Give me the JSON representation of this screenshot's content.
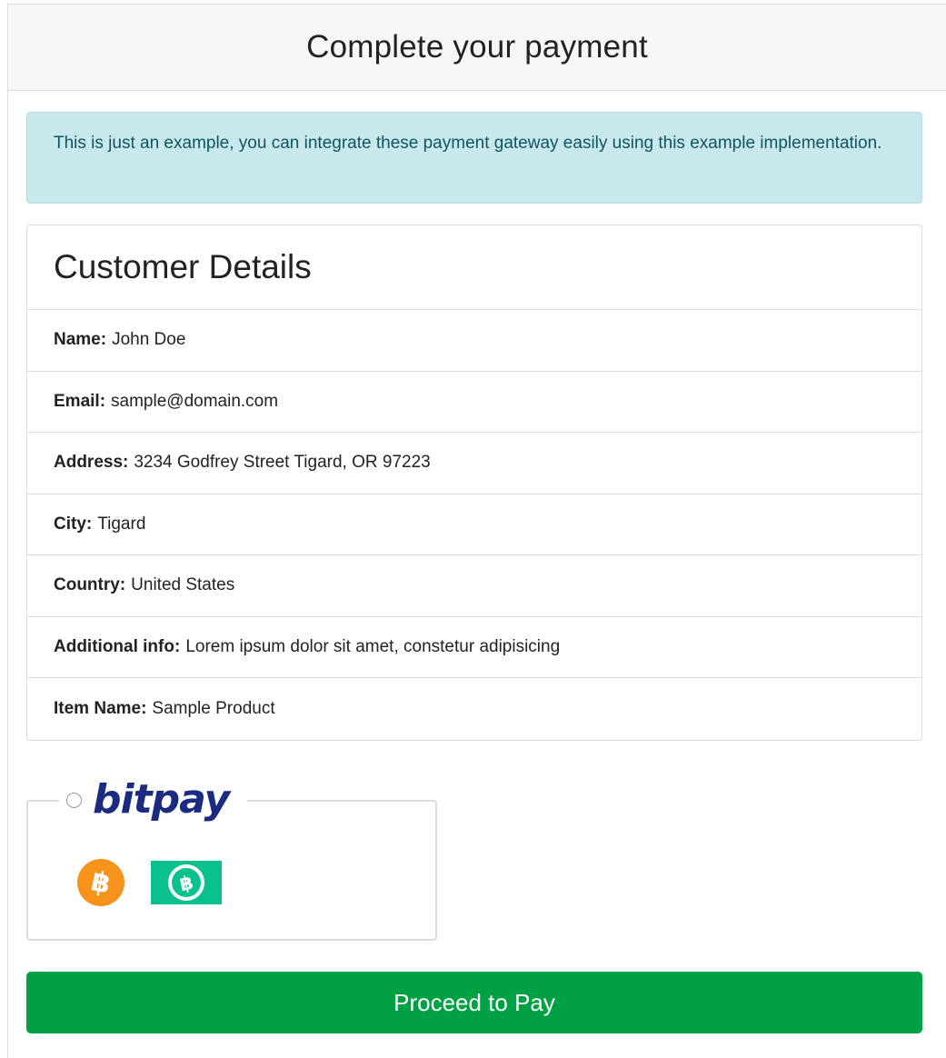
{
  "header": {
    "title": "Complete your payment"
  },
  "alert": {
    "text": "This is just an example, you can integrate these payment gateway easily using this example implementation."
  },
  "customer": {
    "heading": "Customer Details",
    "rows": [
      {
        "label": "Name:",
        "value": "John Doe"
      },
      {
        "label": "Email:",
        "value": "sample@domain.com"
      },
      {
        "label": "Address:",
        "value": "3234 Godfrey Street Tigard, OR 97223"
      },
      {
        "label": "City:",
        "value": "Tigard"
      },
      {
        "label": "Country:",
        "value": "United States"
      },
      {
        "label": "Additional info:",
        "value": "Lorem ipsum dolor sit amet, constetur adipisicing"
      },
      {
        "label": "Item Name:",
        "value": "Sample Product"
      }
    ]
  },
  "gateway": {
    "name": "bitpay",
    "selected": false,
    "icons": [
      "bitcoin-icon",
      "bitcoin-cash-icon"
    ],
    "colors": {
      "brand": "#1a2b80",
      "bitcoin": "#f7931a",
      "bitcoin_cash": "#0ac18e"
    }
  },
  "actions": {
    "pay_label": "Proceed to Pay",
    "pay_color": "#00a045"
  },
  "theme": {
    "alert_bg": "#c9e8ec",
    "alert_text": "#0d5660",
    "border": "#dcdcdc",
    "header_bg": "#f7f7f7"
  }
}
